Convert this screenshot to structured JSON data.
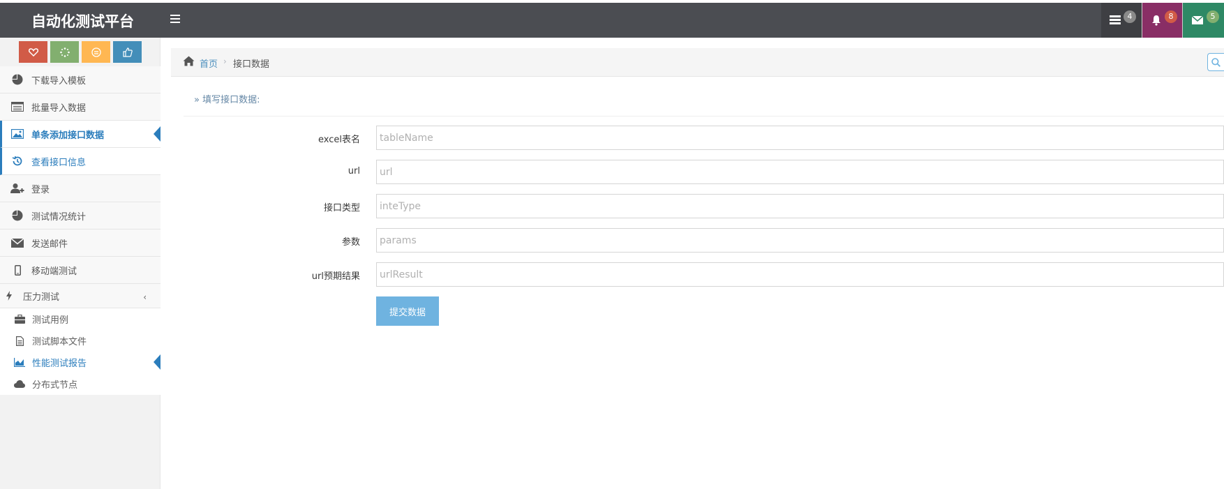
{
  "app": {
    "brand": "自动化测试平台"
  },
  "navbar": {
    "tasks_count": "4",
    "notifications_count": "8",
    "messages_count": "5"
  },
  "sidebar": {
    "items": [
      {
        "label": "下载导入模板",
        "icon": "pie-chart-icon"
      },
      {
        "label": "批量导入数据",
        "icon": "list-alt-icon"
      },
      {
        "label": "单条添加接口数据",
        "icon": "picture-icon"
      },
      {
        "label": "查看接口信息",
        "icon": "history-icon"
      },
      {
        "label": "登录",
        "icon": "user-plus-icon"
      },
      {
        "label": "测试情况统计",
        "icon": "pie-chart-icon"
      },
      {
        "label": "发送邮件",
        "icon": "envelope-icon"
      },
      {
        "label": "移动端测试",
        "icon": "mobile-icon"
      },
      {
        "label": "压力测试",
        "icon": "bolt-icon"
      }
    ],
    "subitems": [
      {
        "label": "测试用例",
        "icon": "briefcase-icon"
      },
      {
        "label": "测试脚本文件",
        "icon": "file-text-icon"
      },
      {
        "label": "性能测试报告",
        "icon": "area-chart-icon"
      },
      {
        "label": "分布式节点",
        "icon": "cloud-icon"
      }
    ]
  },
  "breadcrumb": {
    "home": "首页",
    "current": "接口数据"
  },
  "form": {
    "section_title": "» 填写接口数据:",
    "fields": [
      {
        "label": "excel表名",
        "placeholder": "tableName"
      },
      {
        "label": "url",
        "placeholder": "url"
      },
      {
        "label": "接口类型",
        "placeholder": "inteType"
      },
      {
        "label": "参数",
        "placeholder": "params"
      },
      {
        "label": "url预期结果",
        "placeholder": "urlResult"
      }
    ],
    "submit_label": "提交数据"
  },
  "colors": {
    "navbar": "#4b4d52",
    "accent": "#2b7dbc",
    "submit": "#6fb3e0"
  }
}
